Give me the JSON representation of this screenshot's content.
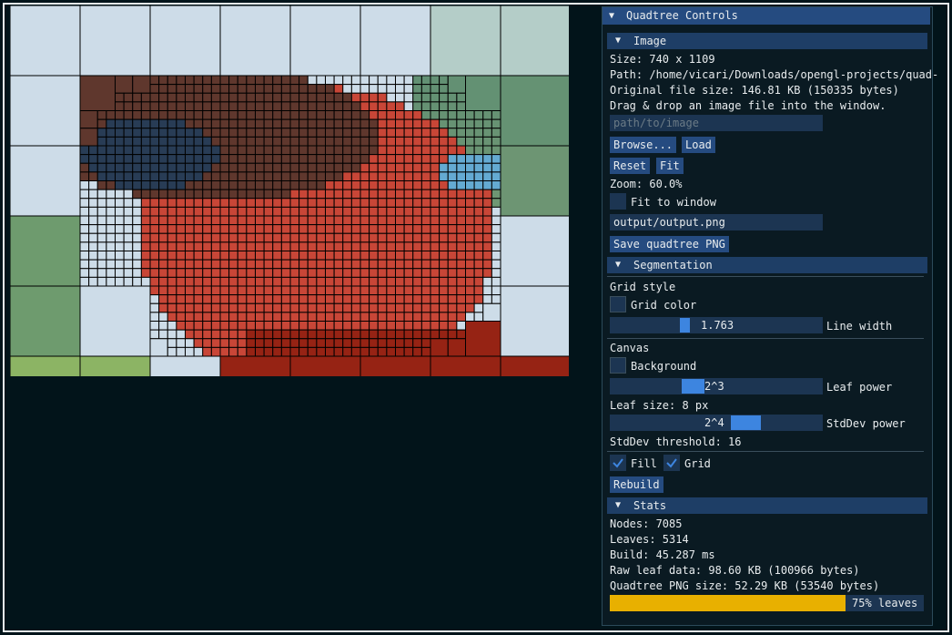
{
  "window": {
    "title": "Quadtree Controls"
  },
  "image_section": {
    "header": "Image",
    "size": "Size: 740 x 1109",
    "path": "Path: /home/vicari/Downloads/opengl-projects/quad-",
    "original_size": "Original file size: 146.81 KB (150335 bytes)",
    "hint": "Drag & drop an image file into the window.",
    "path_placeholder": "path/to/image",
    "browse": "Browse...",
    "load": "Load",
    "reset": "Reset",
    "fit": "Fit",
    "zoom": "Zoom: 60.0%",
    "fit_to_window": "Fit to window",
    "fit_to_window_checked": false,
    "output_path": "output/output.png",
    "save": "Save quadtree PNG"
  },
  "segmentation": {
    "header": "Segmentation",
    "grid_style": "Grid style",
    "grid_color_label": "Grid color",
    "grid_color": "#000000",
    "line_width_value": "1.763",
    "line_width_label": "Line width",
    "canvas_label": "Canvas",
    "background_label": "Background",
    "background_color": "#02141a",
    "leaf_power_value": "2^3",
    "leaf_power_label": "Leaf power",
    "leaf_size": "Leaf size: 8 px",
    "stddev_power_value": "2^4",
    "stddev_power_label": "StdDev power",
    "stddev_threshold": "StdDev threshold: 16",
    "fill_label": "Fill",
    "fill_checked": true,
    "grid_label": "Grid",
    "grid_checked": true,
    "rebuild": "Rebuild"
  },
  "stats": {
    "header": "Stats",
    "nodes": "Nodes:  7085",
    "leaves": "Leaves: 5314",
    "build": "Build:  45.287 ms",
    "raw": "Raw leaf data: 98.60 KB (100966 bytes)",
    "png_size": "Quadtree PNG size: 52.29 KB (53540 bytes)",
    "progress_label": "75% leaves",
    "progress_fraction": 0.75,
    "progress_color": "#e8b000"
  },
  "colors": {
    "accent": "#3d85e0",
    "header": "#254b80",
    "frame_bg": "#1c3552"
  }
}
